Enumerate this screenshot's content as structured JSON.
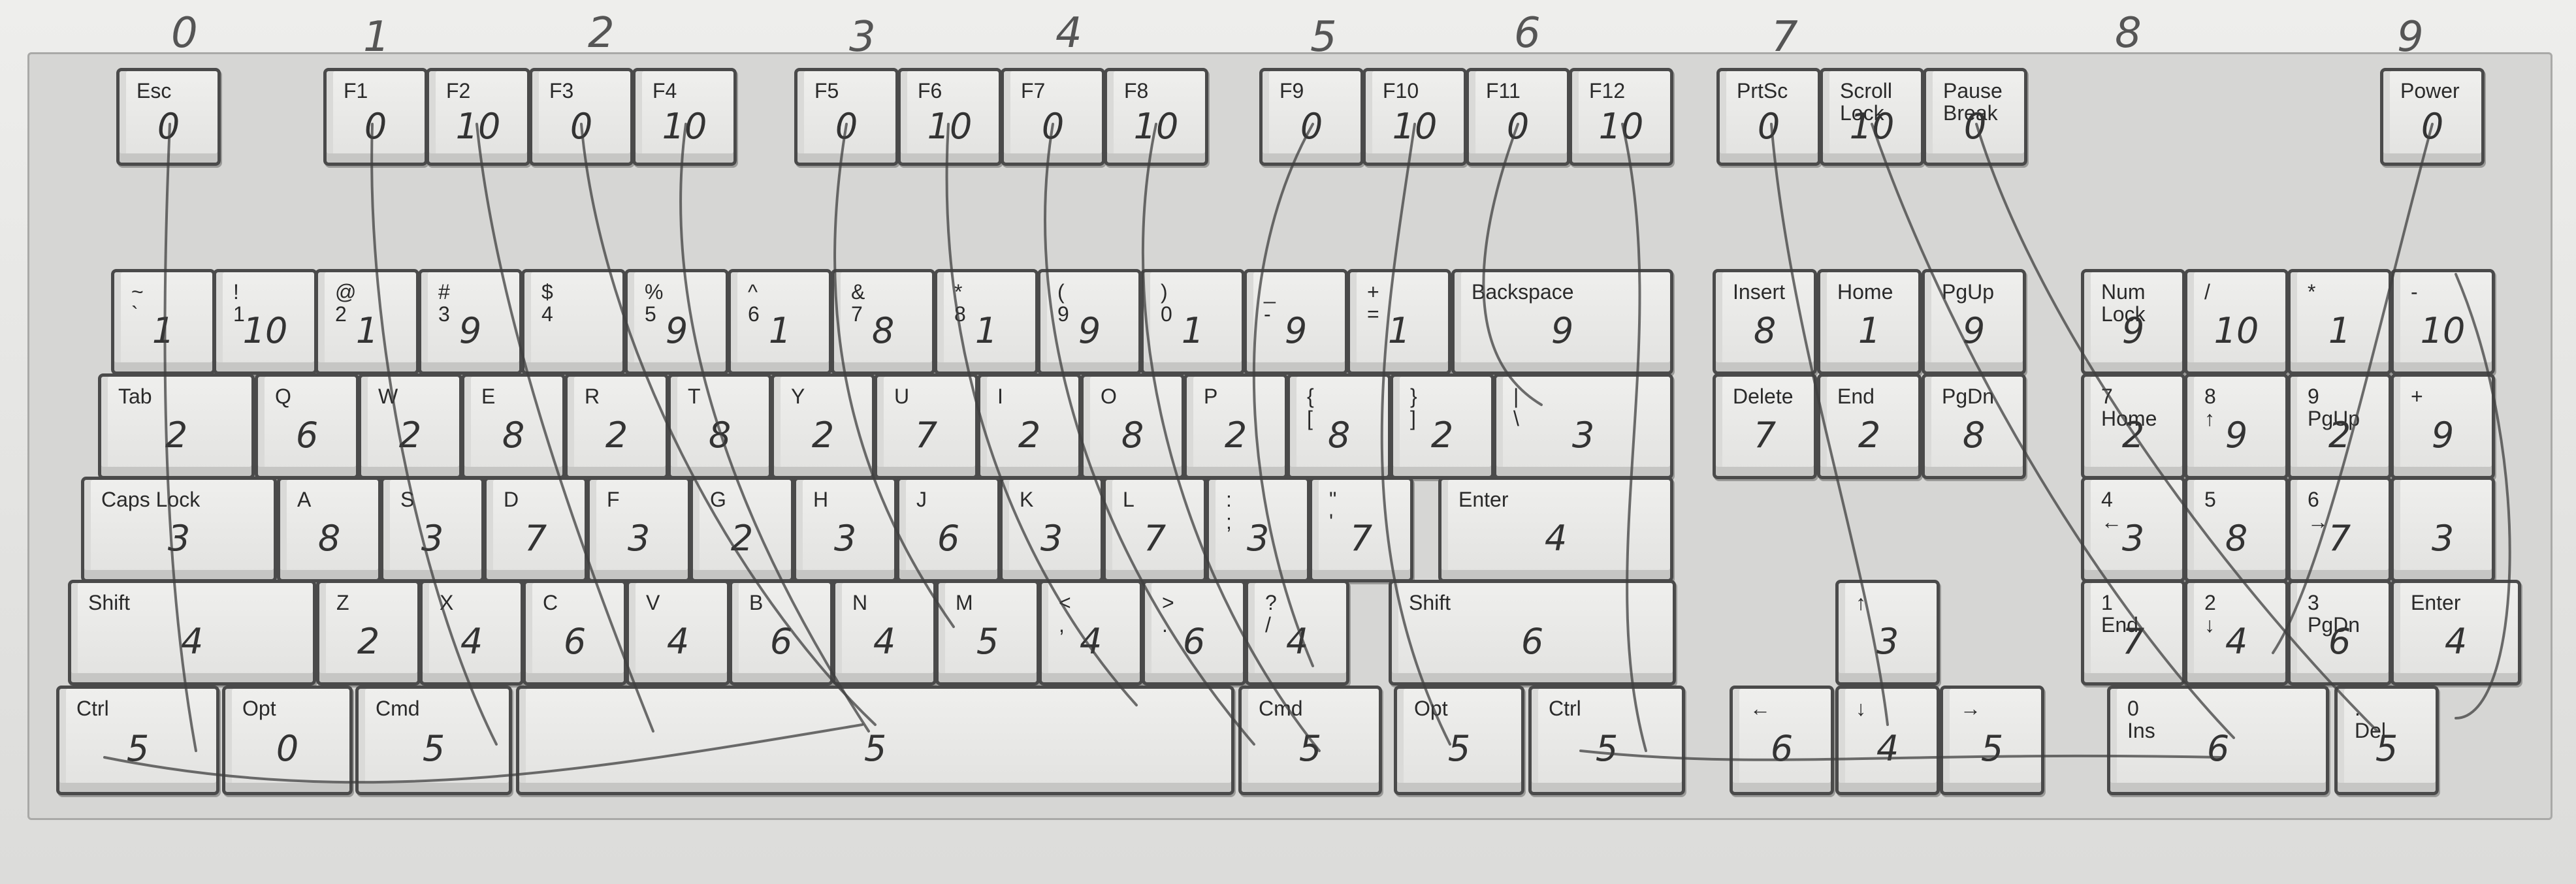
{
  "column_numbers": [
    "0",
    "1",
    "2",
    "3",
    "4",
    "5",
    "6",
    "7",
    "8",
    "9"
  ],
  "keys": [
    {
      "label": "Esc",
      "mark": "0"
    },
    {
      "label": "F1",
      "mark": "0"
    },
    {
      "label": "F2",
      "mark": "10"
    },
    {
      "label": "F3",
      "mark": "0"
    },
    {
      "label": "F4",
      "mark": "10"
    },
    {
      "label": "F5",
      "mark": "0"
    },
    {
      "label": "F6",
      "mark": "10"
    },
    {
      "label": "F7",
      "mark": "0"
    },
    {
      "label": "F8",
      "mark": "10"
    },
    {
      "label": "F9",
      "mark": "0"
    },
    {
      "label": "F10",
      "mark": "10"
    },
    {
      "label": "F11",
      "mark": "0"
    },
    {
      "label": "F12",
      "mark": "10"
    },
    {
      "label": "PrtSc",
      "mark": "0"
    },
    {
      "label": "Scroll\nLock",
      "mark": "10"
    },
    {
      "label": "Pause\nBreak",
      "mark": "0"
    },
    {
      "label": "Power",
      "mark": "0"
    },
    {
      "label": "~\n`",
      "mark": "1"
    },
    {
      "label": "!\n1",
      "mark": "10"
    },
    {
      "label": "@\n2",
      "mark": "1"
    },
    {
      "label": "#\n3",
      "mark": "9"
    },
    {
      "label": "$\n4",
      "mark": ""
    },
    {
      "label": "%\n5",
      "mark": "9"
    },
    {
      "label": "^\n6",
      "mark": "1"
    },
    {
      "label": "&\n7",
      "mark": "8"
    },
    {
      "label": "*\n8",
      "mark": "1"
    },
    {
      "label": "(\n9",
      "mark": "9"
    },
    {
      "label": ")\n0",
      "mark": "1"
    },
    {
      "label": "_\n-",
      "mark": "9"
    },
    {
      "label": "+\n=",
      "mark": "1"
    },
    {
      "label": "Backspace",
      "mark": "9"
    },
    {
      "label": "Insert",
      "mark": "8"
    },
    {
      "label": "Home",
      "mark": "1"
    },
    {
      "label": "PgUp",
      "mark": "9"
    },
    {
      "label": "Num\nLock",
      "mark": "9"
    },
    {
      "label": "/",
      "mark": "10"
    },
    {
      "label": "*",
      "mark": "1"
    },
    {
      "label": "-",
      "mark": "10"
    },
    {
      "label": "Tab",
      "mark": "2"
    },
    {
      "label": "Q",
      "mark": "6"
    },
    {
      "label": "W",
      "mark": "2"
    },
    {
      "label": "E",
      "mark": "8"
    },
    {
      "label": "R",
      "mark": "2"
    },
    {
      "label": "T",
      "mark": "8"
    },
    {
      "label": "Y",
      "mark": "2"
    },
    {
      "label": "U",
      "mark": "7"
    },
    {
      "label": "I",
      "mark": "2"
    },
    {
      "label": "O",
      "mark": "8"
    },
    {
      "label": "P",
      "mark": "2"
    },
    {
      "label": "{\n[",
      "mark": "8"
    },
    {
      "label": "}\n]",
      "mark": "2"
    },
    {
      "label": "|\n\\",
      "mark": "3"
    },
    {
      "label": "Delete",
      "mark": "7"
    },
    {
      "label": "End",
      "mark": "2"
    },
    {
      "label": "PgDn",
      "mark": "8"
    },
    {
      "label": "7\nHome",
      "mark": "2"
    },
    {
      "label": "8\n↑",
      "mark": "9"
    },
    {
      "label": "9\nPgUp",
      "mark": "2"
    },
    {
      "label": "+",
      "mark": "9"
    },
    {
      "label": "Caps Lock",
      "mark": "3"
    },
    {
      "label": "A",
      "mark": "8"
    },
    {
      "label": "S",
      "mark": "3"
    },
    {
      "label": "D",
      "mark": "7"
    },
    {
      "label": "F",
      "mark": "3"
    },
    {
      "label": "G",
      "mark": "2"
    },
    {
      "label": "H",
      "mark": "3"
    },
    {
      "label": "J",
      "mark": "6"
    },
    {
      "label": "K",
      "mark": "3"
    },
    {
      "label": "L",
      "mark": "7"
    },
    {
      "label": ":\n;",
      "mark": "3"
    },
    {
      "label": "\"\n'",
      "mark": "7"
    },
    {
      "label": "Enter",
      "mark": "4"
    },
    {
      "label": "4\n←",
      "mark": "3"
    },
    {
      "label": "5",
      "mark": "8"
    },
    {
      "label": "6\n→",
      "mark": "7"
    },
    {
      "label": "",
      "mark": "3"
    },
    {
      "label": "Shift",
      "mark": "4"
    },
    {
      "label": "Z",
      "mark": "2"
    },
    {
      "label": "X",
      "mark": "4"
    },
    {
      "label": "C",
      "mark": "6"
    },
    {
      "label": "V",
      "mark": "4"
    },
    {
      "label": "B",
      "mark": "6"
    },
    {
      "label": "N",
      "mark": "4"
    },
    {
      "label": "M",
      "mark": "5"
    },
    {
      "label": "<\n,",
      "mark": "4"
    },
    {
      "label": ">\n.",
      "mark": "6"
    },
    {
      "label": "?\n/",
      "mark": "4"
    },
    {
      "label": "Shift",
      "mark": "6"
    },
    {
      "label": "↑",
      "mark": "3"
    },
    {
      "label": "1\nEnd",
      "mark": "7"
    },
    {
      "label": "2\n↓",
      "mark": "4"
    },
    {
      "label": "3\nPgDn",
      "mark": "6"
    },
    {
      "label": "Enter",
      "mark": "4"
    },
    {
      "label": "Ctrl",
      "mark": "5"
    },
    {
      "label": "Opt",
      "mark": "0"
    },
    {
      "label": "Cmd",
      "mark": "5"
    },
    {
      "label": "",
      "mark": "5"
    },
    {
      "label": "Cmd",
      "mark": "5"
    },
    {
      "label": "Opt",
      "mark": "5"
    },
    {
      "label": "Ctrl",
      "mark": "5"
    },
    {
      "label": "←",
      "mark": "6"
    },
    {
      "label": "↓",
      "mark": "4"
    },
    {
      "label": "→",
      "mark": "5"
    },
    {
      "label": "0\nIns",
      "mark": "6"
    },
    {
      "label": ".\nDel",
      "mark": "5"
    }
  ]
}
